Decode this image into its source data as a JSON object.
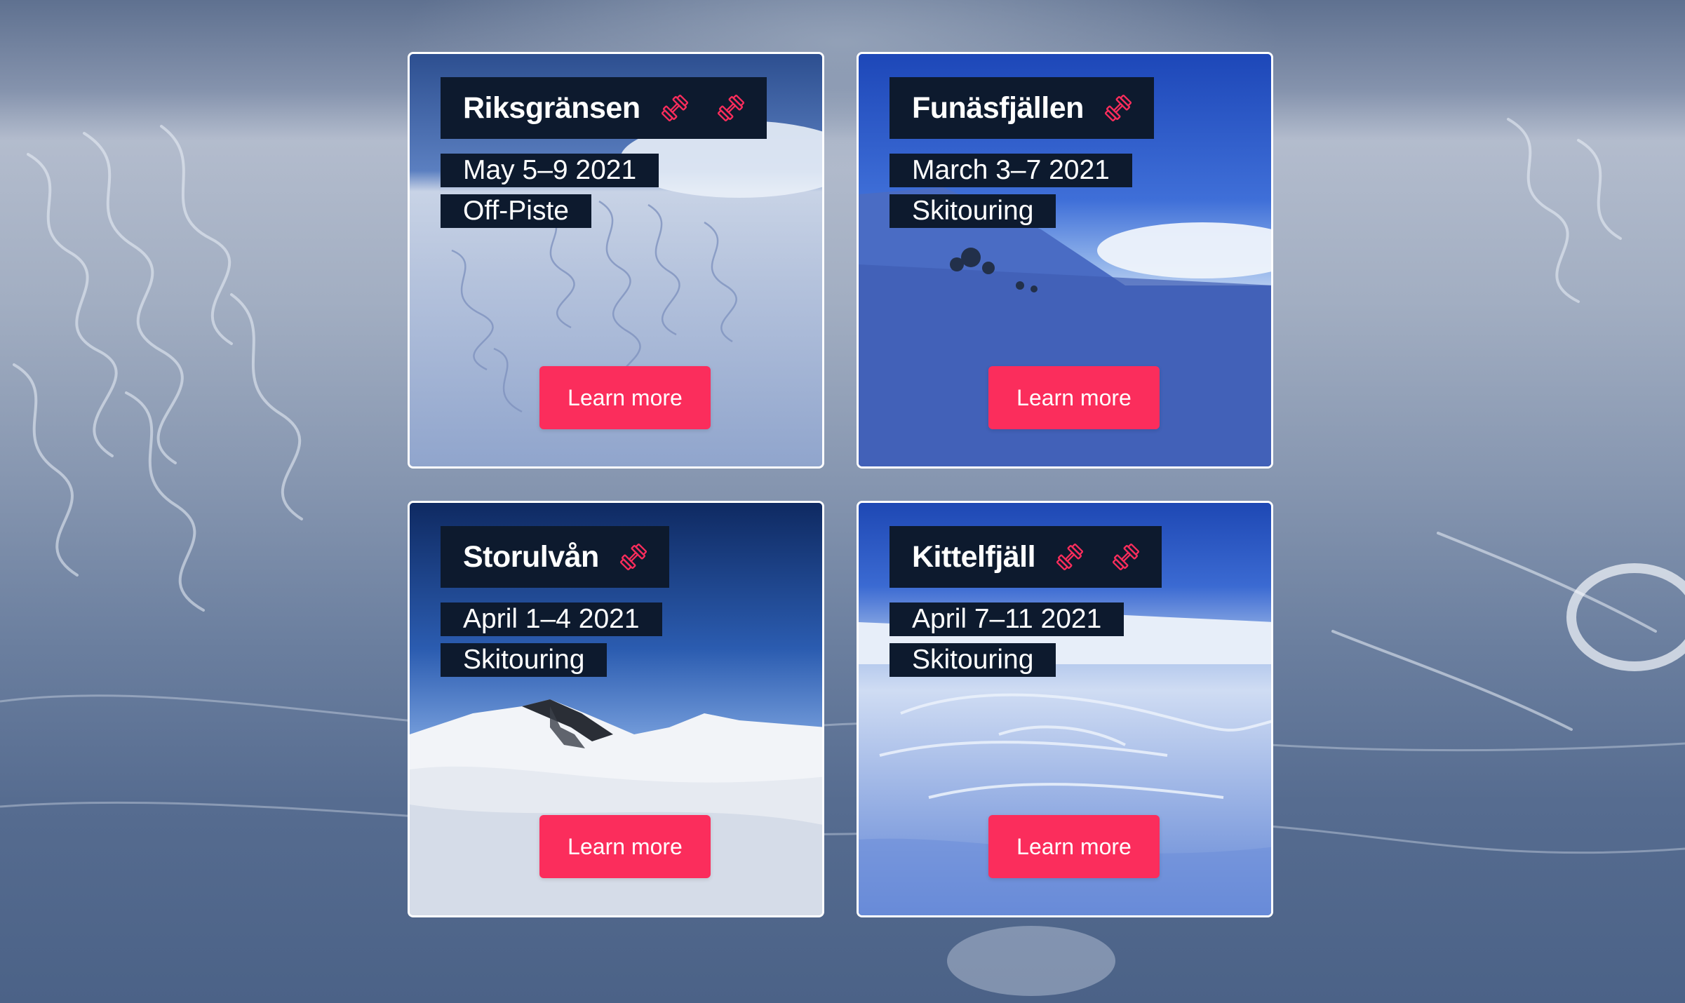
{
  "colors": {
    "accent": "#fb2d5c",
    "label_background": "#0d1a2e",
    "card_border": "#ffffff",
    "icon": "#fb2d5c"
  },
  "trips": [
    {
      "name": "Riksgränsen",
      "date": "May 5–9 2021",
      "type": "Off-Piste",
      "difficulty_icons": 2,
      "icon": "dumbbell-icon",
      "button_label": "Learn more"
    },
    {
      "name": "Funäsfjällen",
      "date": "March 3–7 2021",
      "type": "Skitouring",
      "difficulty_icons": 1,
      "icon": "dumbbell-icon",
      "button_label": "Learn more"
    },
    {
      "name": "Storulvån",
      "date": "April 1–4 2021",
      "type": "Skitouring",
      "difficulty_icons": 1,
      "icon": "dumbbell-icon",
      "button_label": "Learn more"
    },
    {
      "name": "Kittelfjäll",
      "date": "April 7–11 2021",
      "type": "Skitouring",
      "difficulty_icons": 2,
      "icon": "dumbbell-icon",
      "button_label": "Learn more"
    }
  ]
}
